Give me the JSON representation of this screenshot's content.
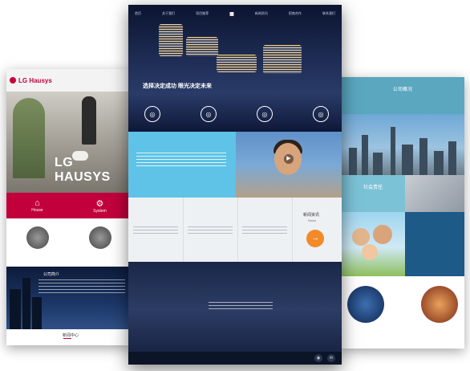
{
  "left": {
    "logo": "LG Hausys",
    "brand": "LG HAUSYS",
    "band_items": [
      {
        "label": "House",
        "icon": "house-icon"
      },
      {
        "label": "System",
        "icon": "system-icon"
      }
    ],
    "city_title": "公司简介",
    "footer_title": "新闻中心"
  },
  "center": {
    "nav_items": [
      "首页",
      "关于我们",
      "项目推荐",
      "新闻资讯",
      "招商合作",
      "联系我们"
    ],
    "slogan": "选择决定成功 眼光决定未来",
    "news_title": "新闻资讯",
    "news_sub": "News",
    "news_arrow": "→"
  },
  "right": {
    "top_title": "公司概况",
    "g1_title": "社会责任"
  },
  "colors": {
    "lg_red": "#c1003c",
    "sky_blue": "#5ec3e7",
    "orange": "#f38a2a",
    "navy": "#0a1430",
    "teal": "#5aa7bf"
  }
}
